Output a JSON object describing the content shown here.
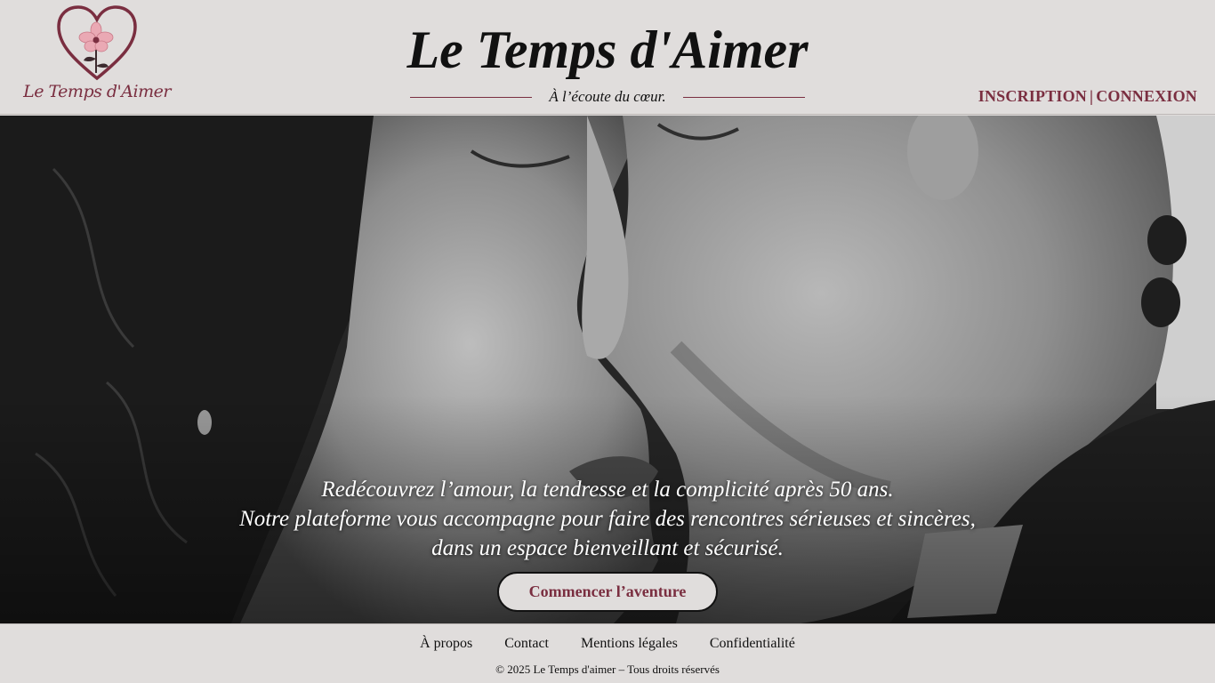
{
  "header": {
    "logo_text": "Le Temps d'Aimer",
    "site_title": "Le Temps d'Aimer",
    "tagline": "À l’écoute du cœur.",
    "auth": {
      "inscription": "INSCRIPTION",
      "separator": "|",
      "connexion": "CONNEXION"
    }
  },
  "hero": {
    "image": "black-and-white-couple-kissing-photo",
    "lines": [
      "Redécouvrez l’amour, la tendresse et la complicité après 50 ans.",
      "Notre plateforme vous accompagne pour faire des rencontres sérieuses et sincères,",
      "dans un espace bienveillant et sécurisé."
    ],
    "cta_label": "Commencer l’aventure"
  },
  "footer": {
    "links": [
      "À propos",
      "Contact",
      "Mentions légales",
      "Confidentialité"
    ],
    "copyright": "© 2025 Le Temps d'aimer – Tous droits réservés"
  },
  "colors": {
    "brand": "#7a2e40",
    "background": "#e0dddc",
    "text": "#111111"
  }
}
